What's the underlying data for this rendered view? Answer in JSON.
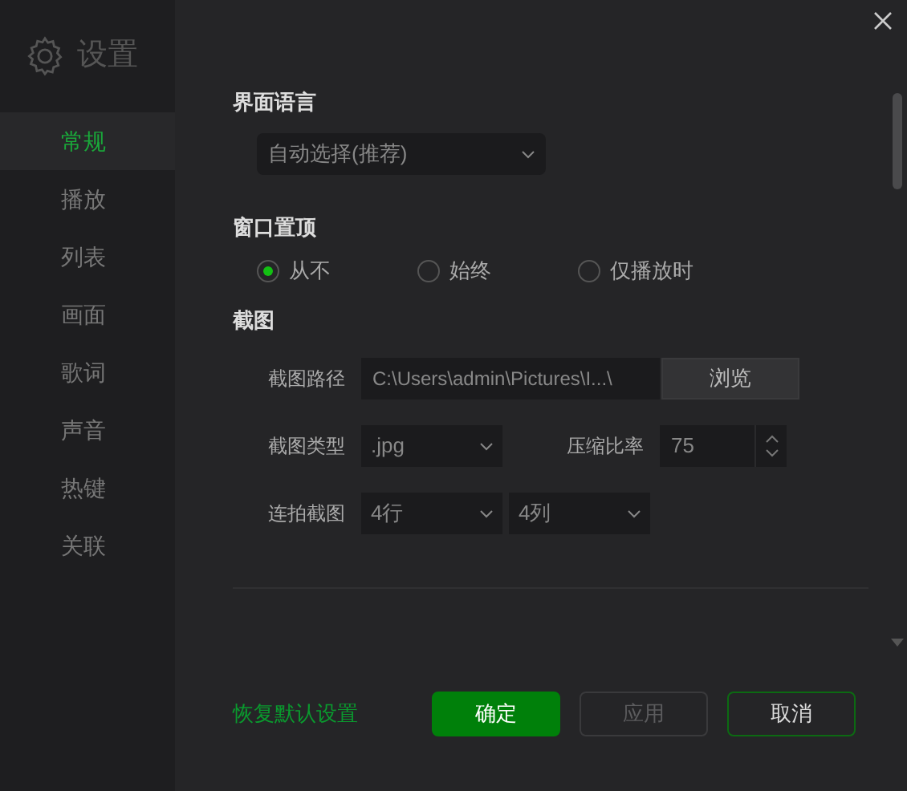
{
  "sidebar": {
    "title": "设置",
    "items": [
      {
        "label": "常规",
        "selected": true
      },
      {
        "label": "播放",
        "selected": false
      },
      {
        "label": "列表",
        "selected": false
      },
      {
        "label": "画面",
        "selected": false
      },
      {
        "label": "歌词",
        "selected": false
      },
      {
        "label": "声音",
        "selected": false
      },
      {
        "label": "热键",
        "selected": false
      },
      {
        "label": "关联",
        "selected": false
      }
    ]
  },
  "language": {
    "title": "界面语言",
    "value": "自动选择(推荐)"
  },
  "topmost": {
    "title": "窗口置顶",
    "options": [
      {
        "label": "从不",
        "selected": true
      },
      {
        "label": "始终",
        "selected": false
      },
      {
        "label": "仅播放时",
        "selected": false
      }
    ]
  },
  "screenshot": {
    "title": "截图",
    "path_label": "截图路径",
    "path": "C:\\Users\\admin\\Pictures\\I...\\",
    "browse": "浏览",
    "type_label": "截图类型",
    "type": ".jpg",
    "ratio_label": "压缩比率",
    "ratio": "75",
    "burst_label": "连拍截图",
    "rows": "4行",
    "cols": "4列"
  },
  "footer": {
    "reset": "恢复默认设置",
    "buttons": [
      {
        "label": "确定",
        "kind": "primary",
        "disabled": false
      },
      {
        "label": "应用",
        "kind": "normal",
        "disabled": true
      },
      {
        "label": "取消",
        "kind": "cancel",
        "disabled": false
      }
    ]
  }
}
